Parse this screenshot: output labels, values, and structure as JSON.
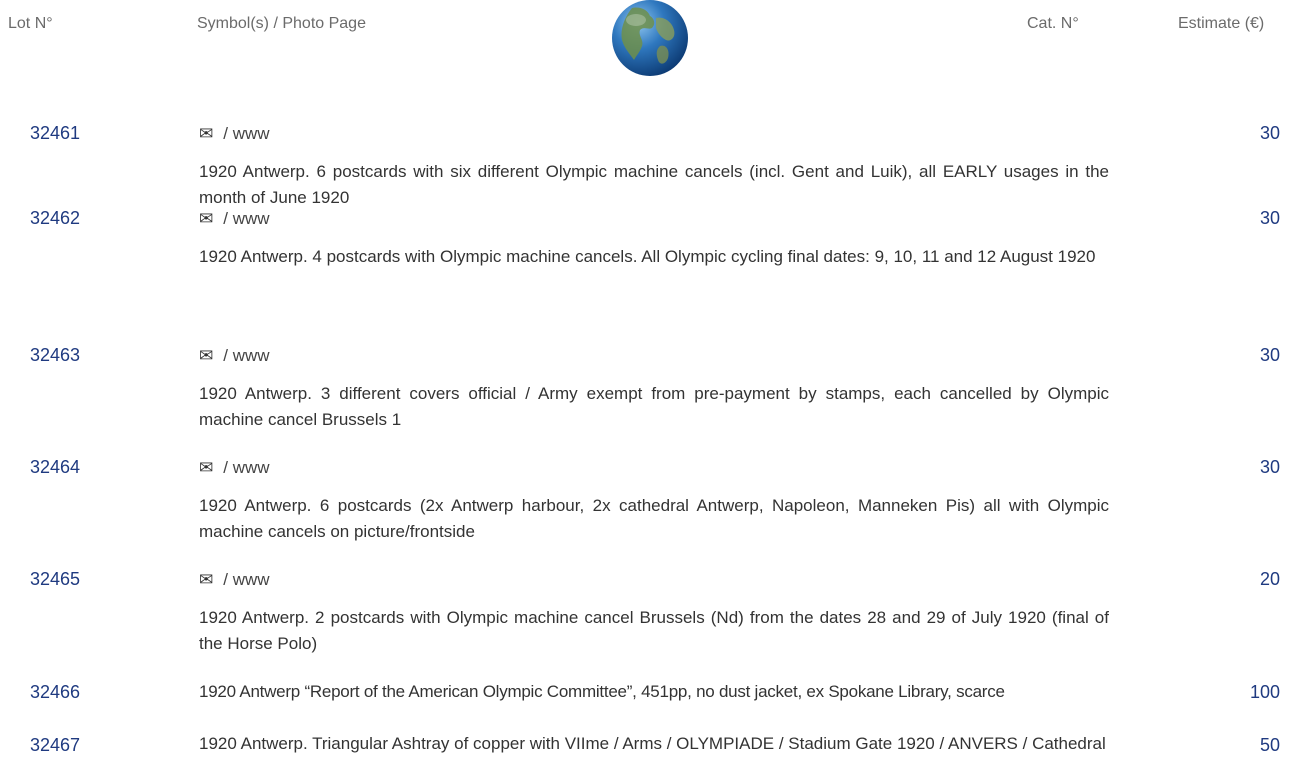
{
  "header": {
    "lot": "Lot N°",
    "symbols": "Symbol(s) / Photo Page",
    "cat": "Cat. N°",
    "estimate": "Estimate (€)"
  },
  "lots": [
    {
      "number": "32461",
      "symbol_icon": "envelope-icon",
      "symbol_text": "/ www",
      "description": "1920 Antwerp. 6 postcards with six different Olympic machine cancels (incl. Gent and Luik), all EARLY usages in the month of June 1920",
      "estimate": "30"
    },
    {
      "number": "32462",
      "symbol_icon": "envelope-icon",
      "symbol_text": "/ www",
      "description": "1920 Antwerp. 4 postcards with Olympic machine cancels. All Olympic cycling final dates: 9, 10, 11 and 12 August 1920",
      "estimate": "30"
    },
    {
      "number": "32463",
      "symbol_icon": "envelope-icon",
      "symbol_text": "/ www",
      "description": "1920 Antwerp. 3 different covers official / Army exempt from pre-payment by stamps, each cancelled by Olympic machine cancel Brussels 1",
      "estimate": "30"
    },
    {
      "number": "32464",
      "symbol_icon": "envelope-icon",
      "symbol_text": "/ www",
      "description": "1920 Antwerp. 6 postcards (2x Antwerp harbour, 2x cathedral Antwerp, Napoleon, Manneken Pis) all with Olympic machine cancels on picture/frontside",
      "estimate": "30"
    },
    {
      "number": "32465",
      "symbol_icon": "envelope-icon",
      "symbol_text": "/ www",
      "description": "1920 Antwerp. 2 postcards with Olympic machine cancel Brussels (Nd) from the dates 28 and 29 of July 1920 (final of the Horse Polo)",
      "estimate": "20"
    },
    {
      "number": "32466",
      "description": "1920 Antwerp “Report of the American Olympic Committee”, 451pp, no dust jacket, ex Spokane Library, scarce",
      "estimate": "100"
    },
    {
      "number": "32467",
      "description": "1920 Antwerp. Triangular Ashtray of copper with VIIme / Arms / OLYMPIADE / Stadium Gate 1920 / ANVERS / Cathedral",
      "estimate": "50"
    }
  ],
  "symbol_glyph": "✉",
  "colors": {
    "lot_number": "#1f3a80",
    "header_text": "#6b6b6b",
    "body_text": "#333333"
  }
}
